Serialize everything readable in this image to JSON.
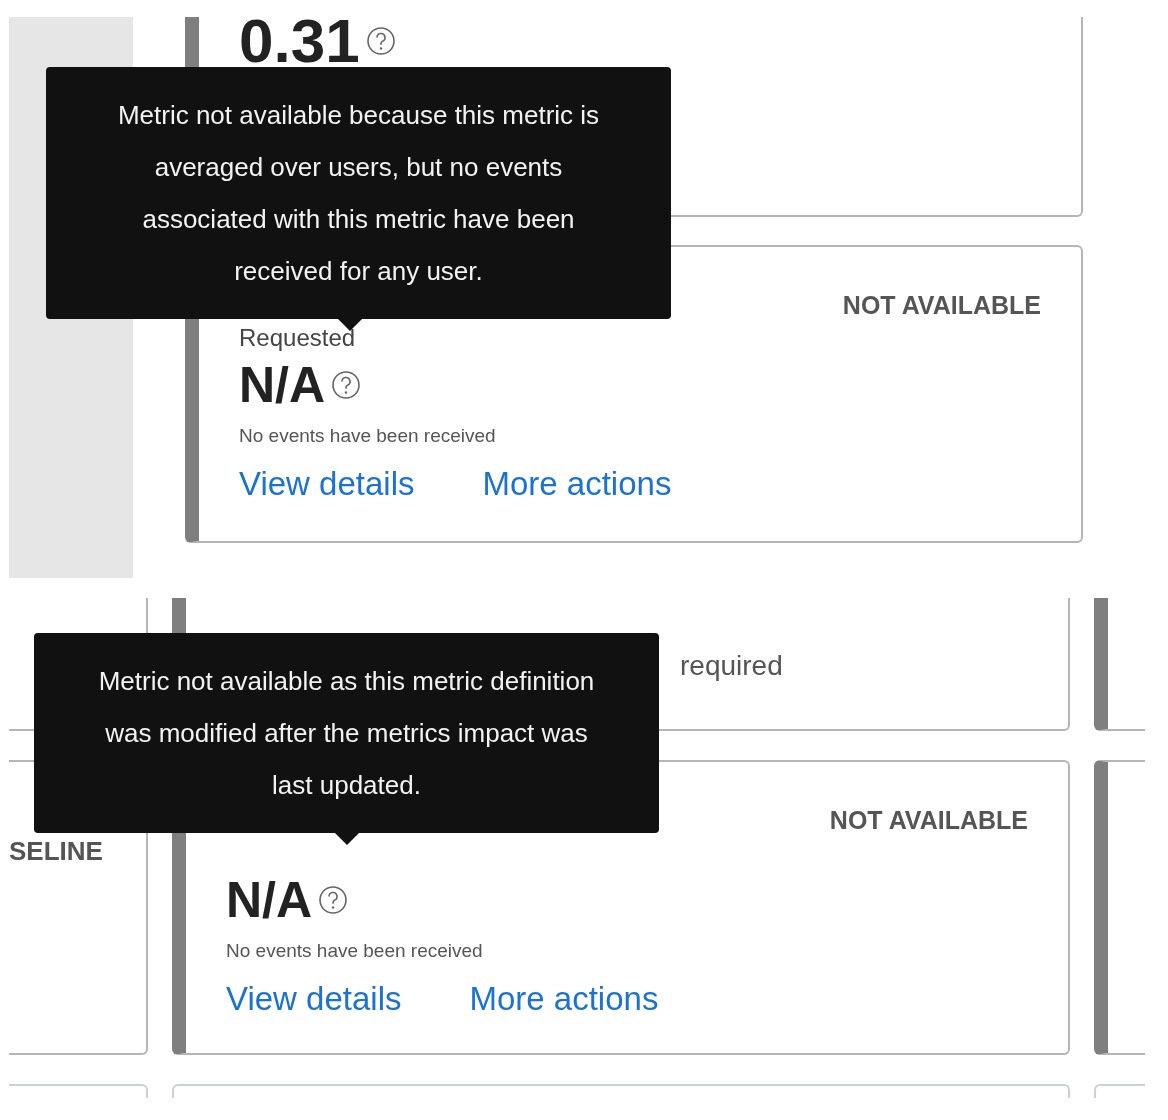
{
  "panels": [
    {
      "kind": "sidebar",
      "cards": [
        {
          "cut": true,
          "value": "0.31"
        },
        {
          "cut": false,
          "title": "Requested",
          "status": "NOT AVAILABLE",
          "value": "N/A",
          "note": "No events have been received",
          "links": [
            "View details",
            "More actions"
          ]
        }
      ],
      "tooltip": "Metric not available because this metric is averaged over users, but no events associated with this metric have been received for any user."
    },
    {
      "kind": "grid",
      "side_label": "SELINE",
      "cards": [
        {
          "cut": true,
          "note": "required"
        },
        {
          "cut": false,
          "status": "NOT AVAILABLE",
          "value": "N/A",
          "note": "No events have been received",
          "links": [
            "View details",
            "More actions"
          ]
        }
      ],
      "tooltip": "Metric not available as this metric definition was modified after the metrics impact was last updated."
    }
  ]
}
